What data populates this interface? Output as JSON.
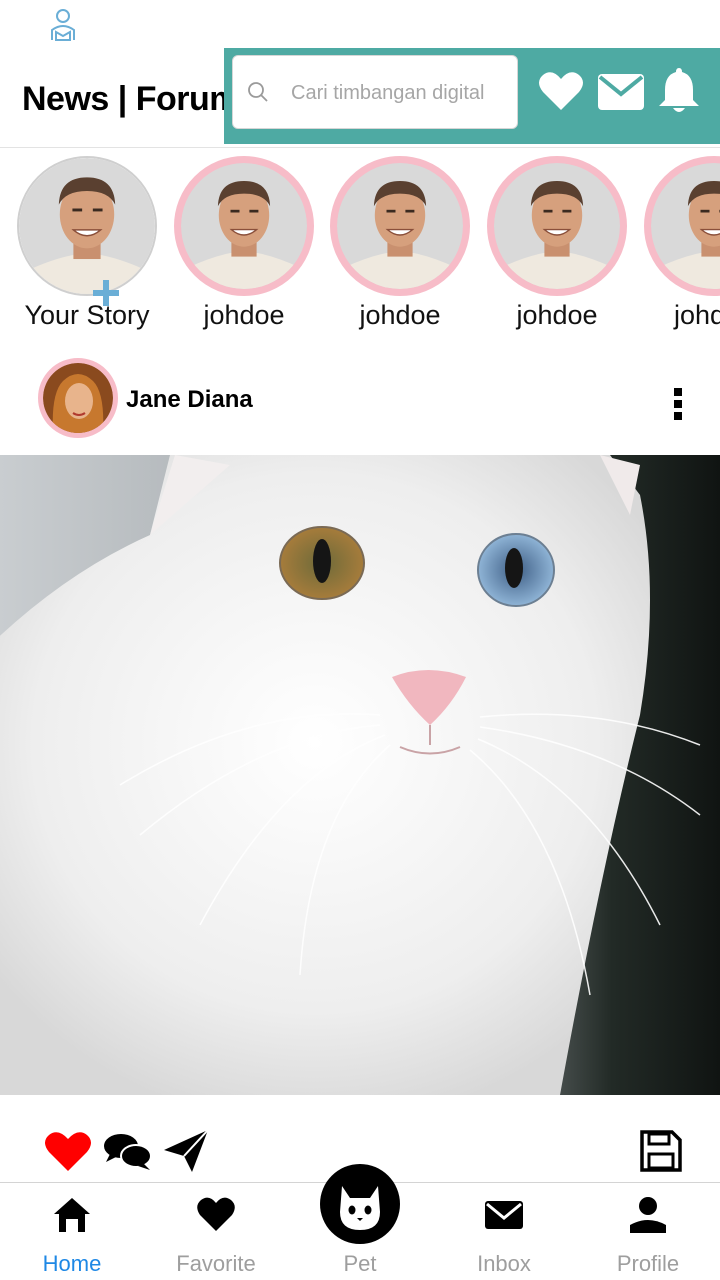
{
  "header": {
    "title": "News | Forum",
    "band_color": "#4eaaa3",
    "search": {
      "placeholder": "Cari timbangan digital",
      "icon": "search-icon"
    },
    "icons": [
      "heart-icon",
      "mail-icon",
      "bell-icon"
    ]
  },
  "stories": [
    {
      "label": "Your Story",
      "add_icon": "plus-icon"
    },
    {
      "label": "johdoe"
    },
    {
      "label": "johdoe"
    },
    {
      "label": "johdoe"
    },
    {
      "label": "johdoe"
    }
  ],
  "post": {
    "author": "Jane Diana",
    "menu_icon": "more-vertical-icon",
    "image": "white-cat-photo",
    "actions": [
      "like-heart-icon",
      "comments-icon",
      "share-send-icon",
      "save-icon"
    ],
    "like_color": "#ff0000"
  },
  "nav": {
    "items": [
      {
        "label": "Home",
        "icon": "home-icon",
        "active": true
      },
      {
        "label": "Favorite",
        "icon": "heart-icon"
      },
      {
        "label": "Pet",
        "icon": "cat-icon"
      },
      {
        "label": "Inbox",
        "icon": "mail-icon"
      },
      {
        "label": "Profile",
        "icon": "person-icon"
      }
    ],
    "active_color": "#1e88e5",
    "inactive_color": "#9e9e9e"
  }
}
